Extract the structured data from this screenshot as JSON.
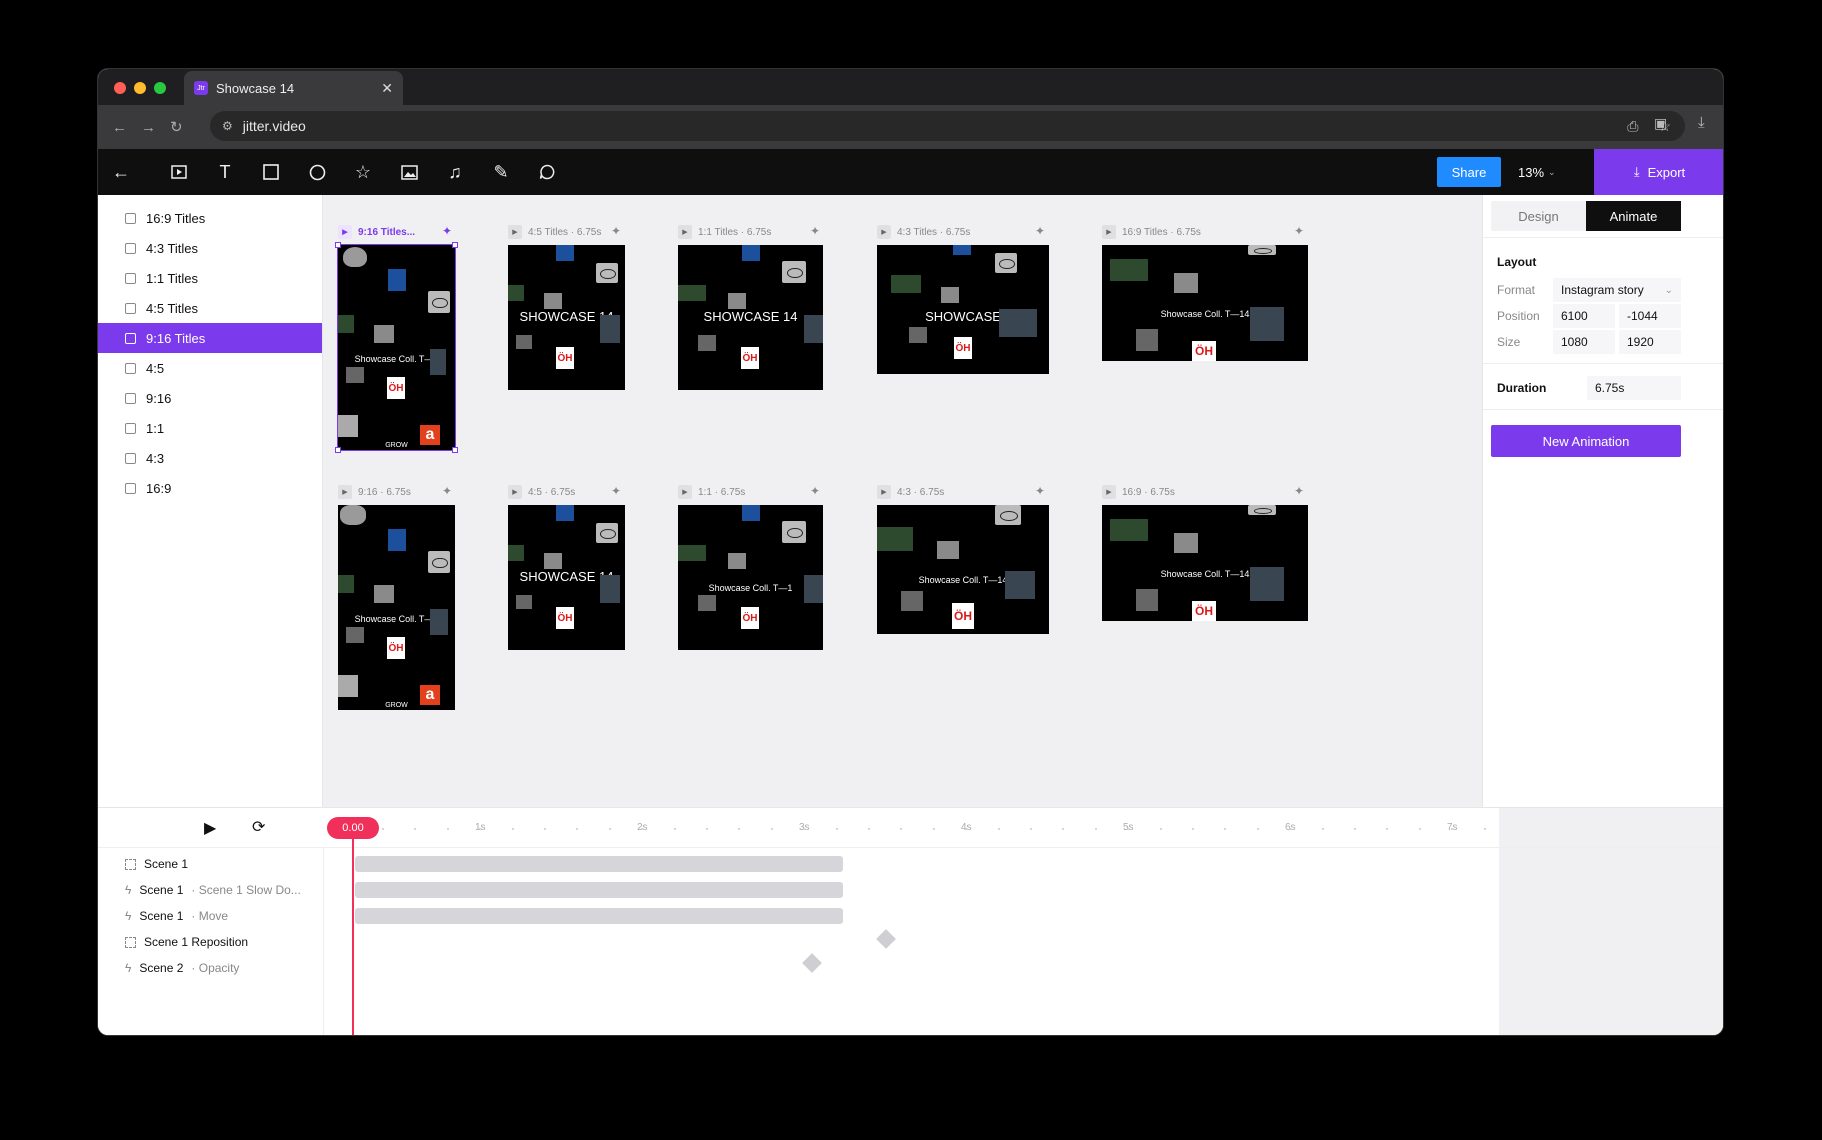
{
  "browser": {
    "tab_title": "Showcase 14",
    "tab_favicon": "Jtr",
    "url": "jitter.video"
  },
  "toolbar": {
    "share_label": "Share",
    "zoom": "13%",
    "export_label": "Export"
  },
  "layers": [
    {
      "label": "16:9 Titles"
    },
    {
      "label": "4:3 Titles"
    },
    {
      "label": "1:1 Titles"
    },
    {
      "label": "4:5 Titles"
    },
    {
      "label": "9:16 Titles",
      "selected": true
    },
    {
      "label": "4:5"
    },
    {
      "label": "9:16"
    },
    {
      "label": "1:1"
    },
    {
      "label": "4:3"
    },
    {
      "label": "16:9"
    }
  ],
  "frames": {
    "r1c1": {
      "label": "9:16 Titles...",
      "title": "Showcase Coll. T—1",
      "oh": "ÖH",
      "a": "a",
      "grow": "GROW"
    },
    "r1c2": {
      "label": "4:5 Titles · 6.75s",
      "title": "SHOWCASE 14",
      "oh": "ÖH"
    },
    "r1c3": {
      "label": "1:1 Titles · 6.75s",
      "title": "SHOWCASE 14",
      "oh": "ÖH"
    },
    "r1c4": {
      "label": "4:3 Titles · 6.75s",
      "title": "SHOWCASE",
      "oh": "ÖH"
    },
    "r1c5": {
      "label": "16:9 Titles · 6.75s",
      "title": "Showcase Coll. T—14",
      "oh": "ÖH"
    },
    "r2c1": {
      "label": "9:16 · 6.75s",
      "title": "Showcase Coll. T—1",
      "oh": "ÖH",
      "a": "a",
      "grow": "GROW"
    },
    "r2c2": {
      "label": "4:5 · 6.75s",
      "title": "SHOWCASE 14",
      "oh": "ÖH"
    },
    "r2c3": {
      "label": "1:1 · 6.75s",
      "title": "Showcase Coll. T—1",
      "oh": "ÖH"
    },
    "r2c4": {
      "label": "4:3 · 6.75s",
      "title": "Showcase Coll. T—14",
      "oh": "ÖH"
    },
    "r2c5": {
      "label": "16:9 · 6.75s",
      "title": "Showcase Coll. T—14",
      "oh": "ÖH"
    }
  },
  "panel": {
    "tab_design": "Design",
    "tab_animate": "Animate",
    "layout_title": "Layout",
    "format_label": "Format",
    "format_value": "Instagram story",
    "position_label": "Position",
    "position_x": "6100",
    "position_y": "-1044",
    "size_label": "Size",
    "size_w": "1080",
    "size_h": "1920",
    "duration_label": "Duration",
    "duration_value": "6.75s",
    "new_animation": "New Animation"
  },
  "timeline": {
    "time": "0.00",
    "ticks": [
      "1s",
      "2s",
      "3s",
      "4s",
      "5s",
      "6s",
      "7s"
    ],
    "tracks": [
      {
        "name": "Scene 1",
        "sub": "",
        "icon": "frame-icon"
      },
      {
        "name": "Scene 1",
        "sub": "· Scene 1 Slow Do...",
        "icon": "bolt-icon"
      },
      {
        "name": "Scene 1",
        "sub": "· Move",
        "icon": "bolt-icon"
      },
      {
        "name": "Scene 1 Reposition",
        "sub": "",
        "icon": "frame-icon"
      },
      {
        "name": "Scene 2",
        "sub": "· Opacity",
        "icon": "bolt-icon"
      }
    ]
  },
  "colors": {
    "accent": "#7c3aed",
    "share": "#1f8bff",
    "playhead": "#f0305a",
    "oh_red": "#d81b1b"
  }
}
